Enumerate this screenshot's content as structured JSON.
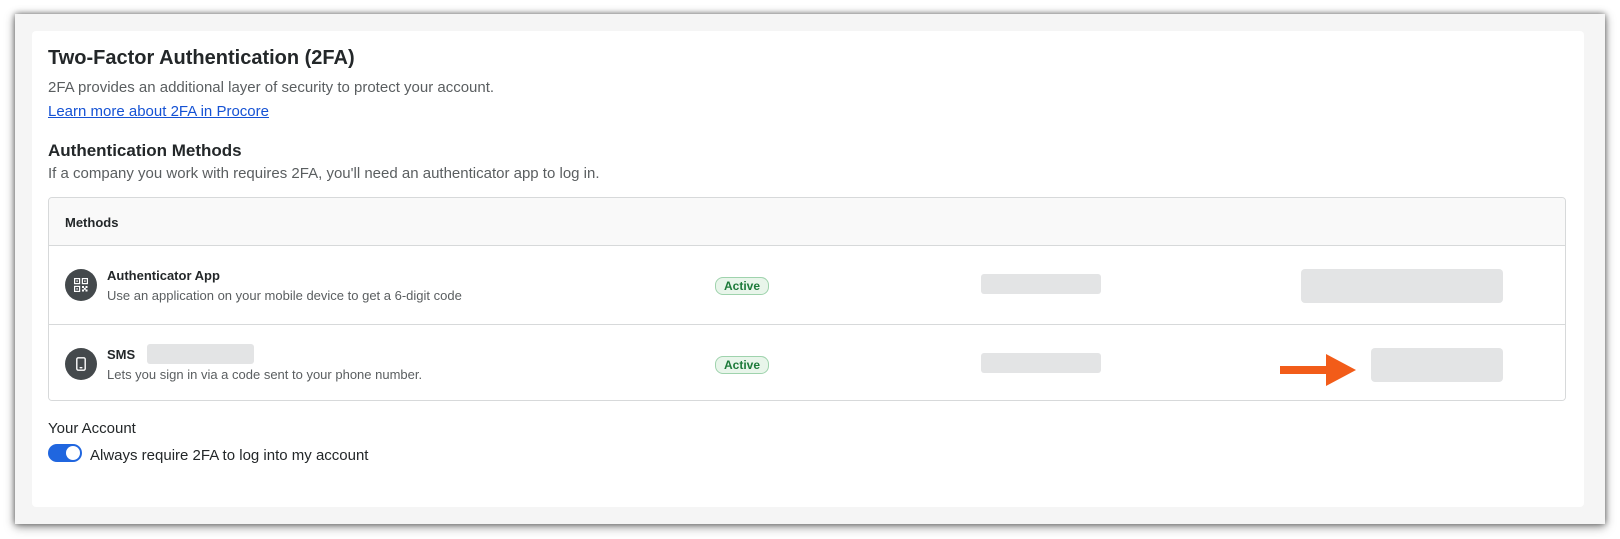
{
  "header": {
    "title": "Two-Factor Authentication (2FA)",
    "description": "2FA provides an additional layer of security to protect your account.",
    "learn_more_link": "Learn more about 2FA in Procore"
  },
  "methods_section": {
    "title": "Authentication Methods",
    "description": "If a company you work with requires 2FA, you'll need an authenticator app to log in.",
    "table_header": "Methods",
    "rows": [
      {
        "name": "Authenticator App",
        "description": "Use an application on your mobile device to get a 6-digit code",
        "status": "Active",
        "icon": "qr-code-icon"
      },
      {
        "name": "SMS",
        "description": "Lets you sign in via a code sent to your phone number.",
        "status": "Active",
        "icon": "mobile-phone-icon"
      }
    ]
  },
  "account": {
    "label": "Your Account",
    "toggle_label": "Always require 2FA to log into my account",
    "toggle_on": true
  },
  "colors": {
    "link": "#1552d4",
    "toggle_on": "#2066df",
    "badge_text": "#1d7a3a",
    "badge_bg": "#e8f5ea",
    "arrow": "#f25c19",
    "icon_bg": "#44494c"
  }
}
